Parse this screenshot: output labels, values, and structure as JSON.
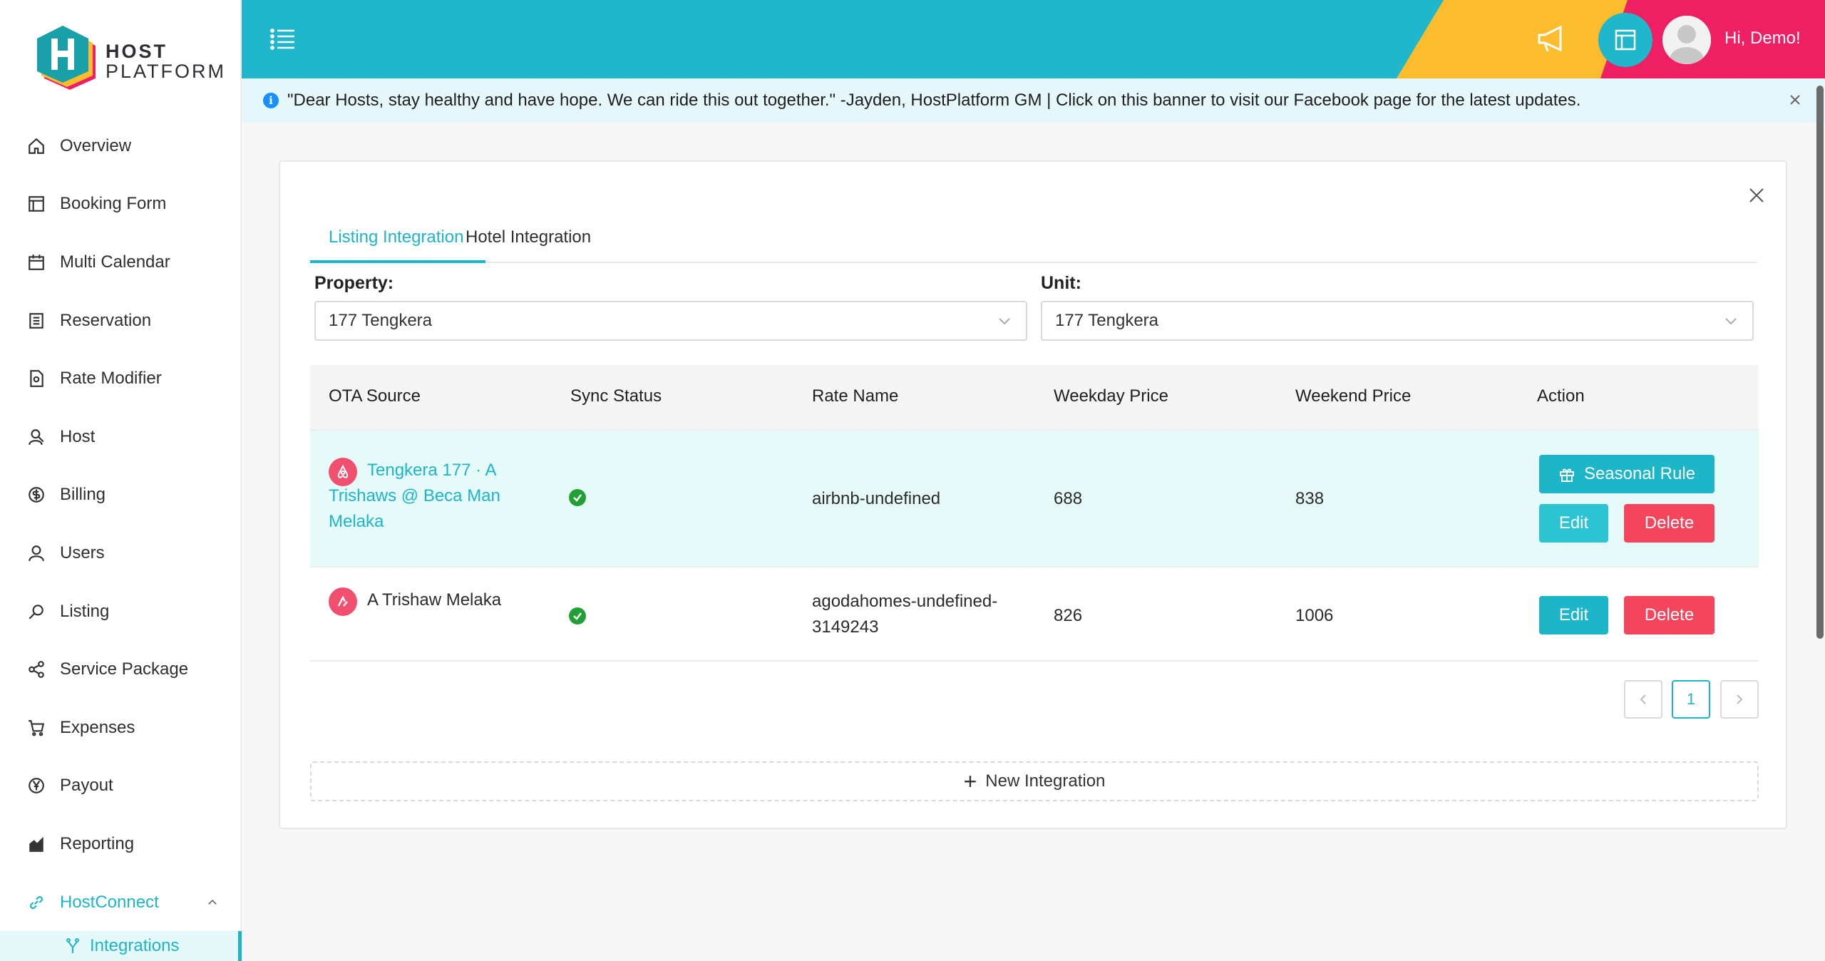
{
  "brand": {
    "line1": "HOST",
    "line2": "PLATFORM"
  },
  "sidebar": {
    "items": [
      {
        "label": "Overview",
        "icon": "home-icon"
      },
      {
        "label": "Booking Form",
        "icon": "form-icon"
      },
      {
        "label": "Multi Calendar",
        "icon": "calendar-icon"
      },
      {
        "label": "Reservation",
        "icon": "list-icon"
      },
      {
        "label": "Rate Modifier",
        "icon": "document-icon"
      },
      {
        "label": "Host",
        "icon": "host-icon"
      },
      {
        "label": "Billing",
        "icon": "billing-icon"
      },
      {
        "label": "Users",
        "icon": "user-icon"
      },
      {
        "label": "Listing",
        "icon": "search-icon"
      },
      {
        "label": "Service Package",
        "icon": "share-icon"
      },
      {
        "label": "Expenses",
        "icon": "cart-icon"
      },
      {
        "label": "Payout",
        "icon": "yen-icon"
      },
      {
        "label": "Reporting",
        "icon": "chart-icon"
      },
      {
        "label": "HostConnect",
        "icon": "link-icon"
      }
    ],
    "sub_item": "Integrations"
  },
  "header": {
    "greeting": "Hi, Demo!"
  },
  "banner": {
    "text": "\"Dear Hosts, stay healthy and have hope. We can ride this out together.\" -Jayden, HostPlatform GM | Click on this banner to visit our Facebook page for the latest updates."
  },
  "tabs": {
    "listing": "Listing Integration",
    "hotel": "Hotel Integration"
  },
  "filters": {
    "property_label": "Property:",
    "property_value": "177 Tengkera",
    "unit_label": "Unit:",
    "unit_value": "177 Tengkera"
  },
  "table": {
    "headers": [
      "OTA Source",
      "Sync Status",
      "Rate Name",
      "Weekday Price",
      "Weekend Price",
      "Action"
    ],
    "rows": [
      {
        "ota_line1": "Tengkera 177 · A",
        "ota_line2": "Trishaws @ Beca Man",
        "ota_line3": "Melaka",
        "rate_name": "airbnb-undefined",
        "weekday": "688",
        "weekend": "838",
        "seasonal": "Seasonal Rule",
        "edit": "Edit",
        "delete": "Delete"
      },
      {
        "ota_line1": "A Trishaw Melaka",
        "rate_line1": "agodahomes-undefined-",
        "rate_line2": "3149243",
        "weekday": "826",
        "weekend": "1006",
        "edit": "Edit",
        "delete": "Delete"
      }
    ]
  },
  "pagination": {
    "current": "1"
  },
  "new_integration": "New Integration",
  "colors": {
    "primary": "#1db5c8",
    "danger": "#f5455c",
    "header_yellow": "#fbbd2e",
    "header_pink": "#ee1f63",
    "airbnb": "#f0506e"
  }
}
